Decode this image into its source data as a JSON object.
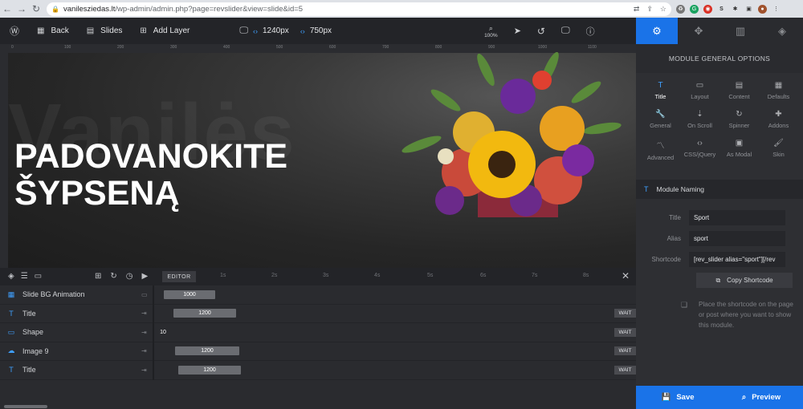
{
  "browser": {
    "url_domain": "vanilesziedas.lt",
    "url_path": "/wp-admin/admin.php?page=revslider&view=slide&id=5"
  },
  "toolbar": {
    "back_label": "Back",
    "slides_label": "Slides",
    "add_layer_label": "Add Layer",
    "width_value": "1240px",
    "height_value": "750px",
    "zoom_label": "100%"
  },
  "ruler": [
    "0",
    "100",
    "200",
    "300",
    "400",
    "500",
    "600",
    "700",
    "800",
    "900",
    "1000",
    "1100"
  ],
  "canvas": {
    "ghost_text": "Vanilės",
    "headline_line1": "PADOVANOKITE",
    "headline_line2": "ŠYPSENĄ"
  },
  "panel": {
    "title": "MODULE GENERAL OPTIONS",
    "grid": [
      {
        "label": "Title",
        "icon": "title-icon",
        "active": true
      },
      {
        "label": "Layout",
        "icon": "layout-icon",
        "active": false
      },
      {
        "label": "Content",
        "icon": "content-icon",
        "active": false
      },
      {
        "label": "Defaults",
        "icon": "defaults-icon",
        "active": false
      },
      {
        "label": "General",
        "icon": "wrench-icon",
        "active": false
      },
      {
        "label": "On Scroll",
        "icon": "scroll-icon",
        "active": false
      },
      {
        "label": "Spinner",
        "icon": "spinner-icon",
        "active": false
      },
      {
        "label": "Addons",
        "icon": "puzzle-icon",
        "active": false
      },
      {
        "label": "Advanced",
        "icon": "chart-icon",
        "active": false
      },
      {
        "label": "CSS/jQuery",
        "icon": "code-icon",
        "active": false
      },
      {
        "label": "As Modal",
        "icon": "modal-icon",
        "active": false
      },
      {
        "label": "Skin",
        "icon": "brush-icon",
        "active": false
      }
    ],
    "section_label": "Module Naming",
    "title_label": "Title",
    "title_value": "Sport",
    "alias_label": "Alias",
    "alias_value": "sport",
    "shortcode_label": "Shortcode",
    "shortcode_value": "[rev_slider alias=\"sport\"][/rev",
    "copy_label": "Copy Shortcode",
    "hint": "Place the shortcode on the page or post where you want to show this module."
  },
  "buttons": {
    "save_label": "Save",
    "preview_label": "Preview"
  },
  "timeline": {
    "editor_label": "EDITOR",
    "ticks": [
      "1s",
      "2s",
      "3s",
      "4s",
      "5s",
      "6s",
      "7s",
      "8s"
    ],
    "layers": [
      {
        "name": "Slide BG Animation",
        "icon": "slide-icon",
        "value": "1000",
        "wait": ""
      },
      {
        "name": "Title",
        "icon": "text-layer-icon",
        "value": "1200",
        "wait": "WAIT"
      },
      {
        "name": "Shape",
        "icon": "shape-icon",
        "value": "10",
        "wait": "WAIT"
      },
      {
        "name": "Image 9",
        "icon": "image-icon",
        "value": "1200",
        "wait": "WAIT"
      },
      {
        "name": "Title",
        "icon": "text-layer-icon",
        "value": "1200",
        "wait": "WAIT"
      }
    ]
  },
  "colors": {
    "accent": "#1a73e8",
    "bg_dark": "#232428",
    "panel_bg": "#2e2f33"
  }
}
